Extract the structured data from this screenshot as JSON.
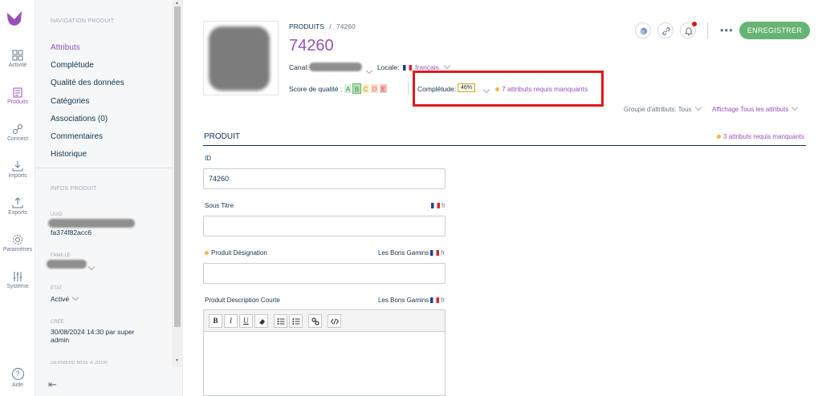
{
  "menu": {
    "items": [
      {
        "label": "Activité",
        "icon": "grid-icon"
      },
      {
        "label": "Produits",
        "icon": "clipboard-icon",
        "active": true
      },
      {
        "label": "Connect",
        "icon": "connect-icon"
      },
      {
        "label": "Imports",
        "icon": "download-icon"
      },
      {
        "label": "Exports",
        "icon": "upload-icon"
      },
      {
        "label": "Paramètres",
        "icon": "gear-icon"
      },
      {
        "label": "Système",
        "icon": "sliders-icon"
      }
    ],
    "help": "Aide",
    "accent": "#9452ba"
  },
  "nav": {
    "title": "NAVIGATION PRODUIT",
    "links": [
      "Attributs",
      "Complétude",
      "Qualité des données",
      "Catégories",
      "Associations (0)",
      "Commentaires",
      "Historique"
    ],
    "info_title": "INFOS PRODUIT",
    "uuid_label": "UUID",
    "uuid_value": "fa374f82acc6",
    "family_label": "FAMILLE",
    "state_label": "ÉTAT",
    "state_value": "Activé",
    "created_label": "CRÉÉ",
    "created_value_line1": "30/08/2024 14:30 par super",
    "created_value_line2": "admin",
    "updated_label": "DERNIÈRE MISE À JOUR"
  },
  "header": {
    "breadcrumb_root": "PRODUITS",
    "breadcrumb_sep": "/",
    "breadcrumb_current": "74260",
    "title": "74260",
    "canal_label": "Canal:",
    "locale_label": "Locale:",
    "locale_value": "français",
    "score_label": "Score de qualité :",
    "score_letters": [
      "A",
      "B",
      "C",
      "D",
      "E"
    ],
    "completude_label": "Complétude:",
    "completude_value": "46%",
    "missing_required": "7 attributs requis manquants",
    "save_label": "ENREGISTRER",
    "more_label": "•••",
    "attr_group": "Groupe d'attributs: Tous",
    "attr_show": "Affichage Tous les attributs"
  },
  "section": {
    "title": "PRODUIT",
    "missing": "3 attributs requis manquants"
  },
  "fields": {
    "id_label": "ID",
    "id_value": "74260",
    "sous_titre_label": "Sous Titre",
    "locale_code": "fr",
    "designation_label": "Produit Désignation",
    "channel": "Les Bons Gamins",
    "desc_courte_label": "Produit Description Courte"
  },
  "rte": {
    "buttons": [
      "B",
      "I",
      "U",
      "eraser-icon",
      "bullet-list-icon",
      "numbered-list-icon",
      "link-icon",
      "code-icon"
    ]
  }
}
